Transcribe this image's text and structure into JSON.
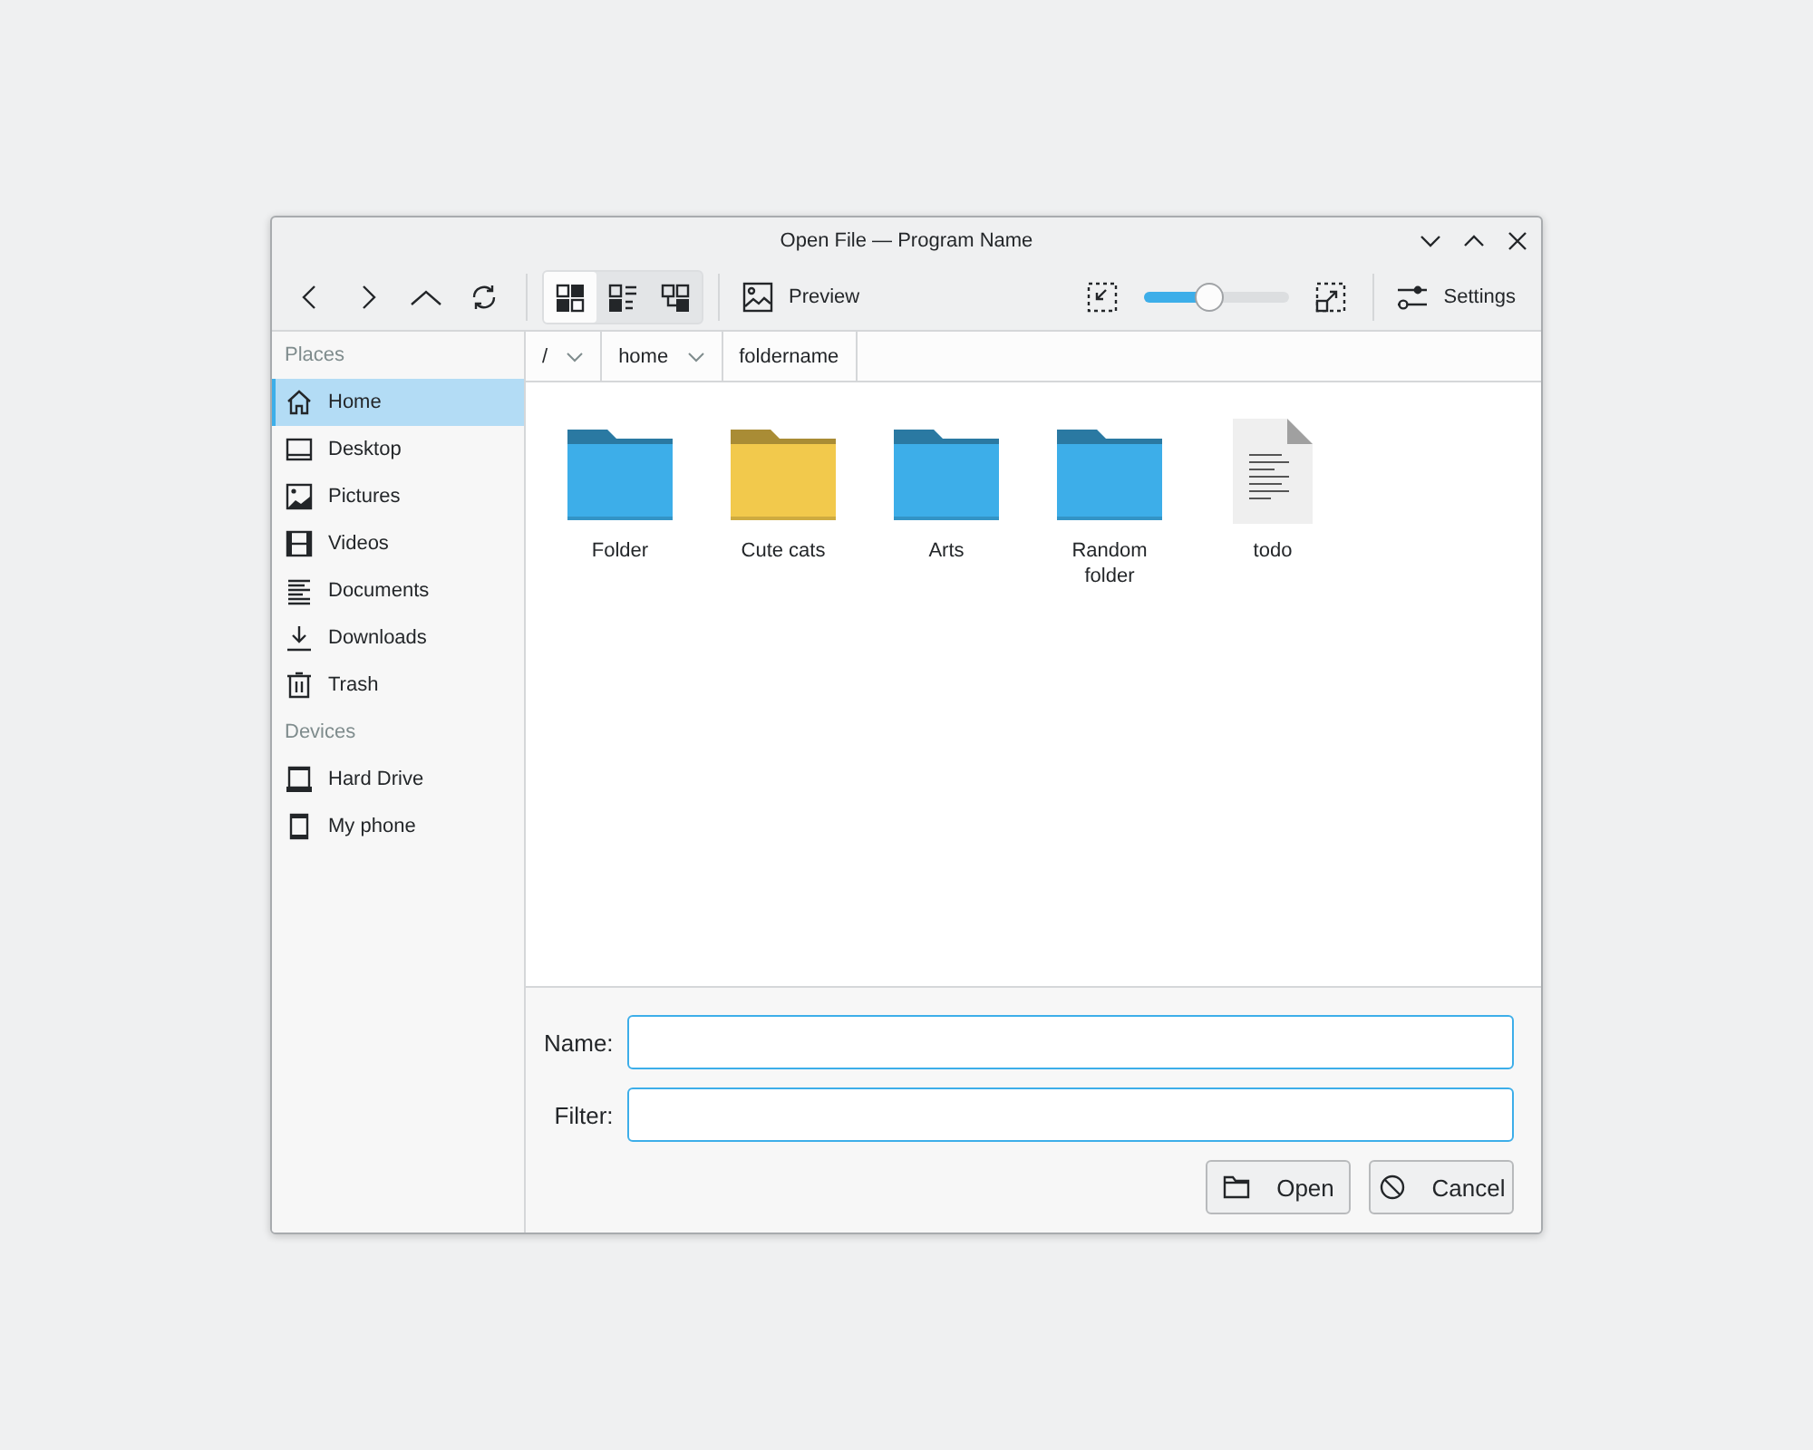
{
  "window": {
    "title": "Open File — Program Name"
  },
  "toolbar": {
    "view_modes": [
      {
        "selected": true
      },
      {
        "selected": false
      },
      {
        "selected": false
      }
    ],
    "preview": {
      "label": "Preview"
    },
    "zoom": {
      "level": 0.45
    },
    "settings": {
      "label": "Settings"
    }
  },
  "sidebar": {
    "sections": [
      {
        "title": "Places",
        "items": [
          {
            "label": "Home",
            "kind": "home",
            "selected": true
          },
          {
            "label": "Desktop",
            "kind": "desktop",
            "selected": false
          },
          {
            "label": "Pictures",
            "kind": "pictures",
            "selected": false
          },
          {
            "label": "Videos",
            "kind": "videos",
            "selected": false
          },
          {
            "label": "Documents",
            "kind": "documents",
            "selected": false
          },
          {
            "label": "Downloads",
            "kind": "downloads",
            "selected": false
          },
          {
            "label": "Trash",
            "kind": "trash",
            "selected": false
          }
        ]
      },
      {
        "title": "Devices",
        "items": [
          {
            "label": "Hard Drive",
            "kind": "drive",
            "selected": false
          },
          {
            "label": "My phone",
            "kind": "phone",
            "selected": false
          }
        ]
      }
    ]
  },
  "breadcrumb": [
    {
      "label": "/",
      "dropdown": true
    },
    {
      "label": "home",
      "dropdown": true
    },
    {
      "label": "foldername",
      "dropdown": false
    }
  ],
  "files": [
    {
      "name": "Folder",
      "kind": "folder",
      "color": "#3daee9"
    },
    {
      "name": "Cute cats",
      "kind": "folder",
      "color": "#f2c94c"
    },
    {
      "name": "Arts",
      "kind": "folder",
      "color": "#3daee9"
    },
    {
      "name": "Random folder",
      "kind": "folder",
      "color": "#3daee9"
    },
    {
      "name": "todo",
      "kind": "document"
    }
  ],
  "form": {
    "fields": [
      {
        "label": "Name:"
      },
      {
        "label": "Filter:"
      }
    ],
    "buttons": [
      {
        "label": "Open",
        "kind": "open"
      },
      {
        "label": "Cancel",
        "kind": "cancel"
      }
    ]
  }
}
